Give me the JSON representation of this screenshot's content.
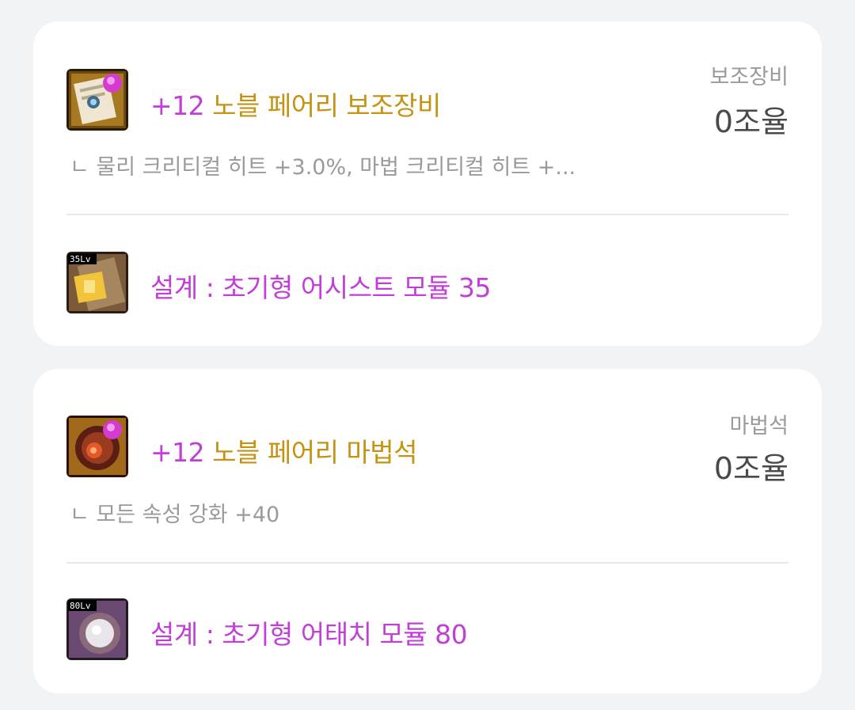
{
  "items": [
    {
      "main": {
        "icon": "noble-fairy-secondary-icon",
        "plus": "+12",
        "name": "노블 페어리 보조장비",
        "slot": "보조장비",
        "price": "0조율",
        "option": "ㄴ 물리 크리티컬 히트 +3.0%, 마법 크리티컬 히트 +..."
      },
      "design": {
        "icon": "assist-module-35-icon",
        "level_badge": "35Lv",
        "title": "설계 : 초기형 어시스트 모듈 35"
      }
    },
    {
      "main": {
        "icon": "noble-fairy-magic-stone-icon",
        "plus": "+12",
        "name": "노블 페어리 마법석",
        "slot": "마법석",
        "price": "0조율",
        "option": "ㄴ 모든 속성 강화 +40"
      },
      "design": {
        "icon": "attach-module-80-icon",
        "level_badge": "80Lv",
        "title": "설계 : 초기형 어태치 모듈 80"
      }
    }
  ],
  "colors": {
    "background": "#f2f3f5",
    "card": "#ffffff",
    "plus_purple": "#c13fd6",
    "item_gold": "#c49313",
    "muted_gray": "#9a9a9a",
    "price_dark": "#4a4a4a"
  }
}
